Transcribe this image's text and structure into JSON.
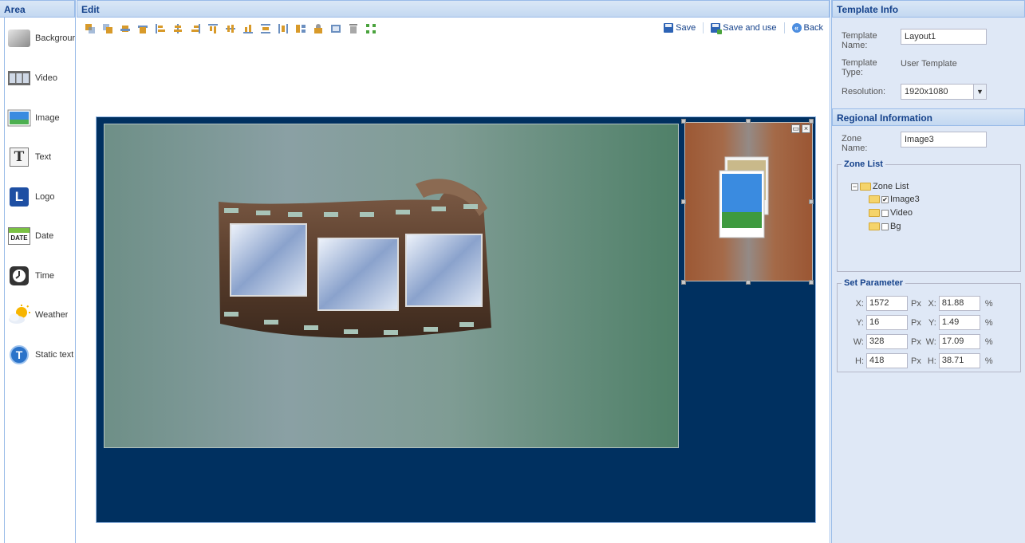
{
  "area": {
    "title": "Area",
    "items": [
      {
        "label": "Backgrour",
        "icon": "background-icon"
      },
      {
        "label": "Video",
        "icon": "video-icon"
      },
      {
        "label": "Image",
        "icon": "image-icon"
      },
      {
        "label": "Text",
        "icon": "text-icon"
      },
      {
        "label": "Logo",
        "icon": "logo-icon"
      },
      {
        "label": "Date",
        "icon": "date-icon"
      },
      {
        "label": "Time",
        "icon": "time-icon"
      },
      {
        "label": "Weather",
        "icon": "weather-icon"
      },
      {
        "label": "Static text",
        "icon": "static-text-icon"
      }
    ],
    "logo_letter": "L",
    "date_badge": "DATE",
    "text_glyph": "T",
    "static_glyph": "T"
  },
  "edit": {
    "title": "Edit",
    "toolbar": {
      "save_label": "Save",
      "save_and_use_label": "Save and use",
      "back_label": "Back"
    }
  },
  "template_info": {
    "title": "Template Info",
    "name_label": "Template Name:",
    "name_value": "Layout1",
    "type_label": "Template Type:",
    "type_value": "User Template",
    "resolution_label": "Resolution:",
    "resolution_value": "1920x1080"
  },
  "regional_info": {
    "title": "Regional Information",
    "zone_name_label": "Zone Name:",
    "zone_name_value": "Image3",
    "zone_list_legend": "Zone List",
    "tree_root": "Zone List",
    "tree_items": [
      {
        "label": "Image3",
        "checked": true
      },
      {
        "label": "Video",
        "checked": false
      },
      {
        "label": "Bg",
        "checked": false
      }
    ]
  },
  "set_parameter": {
    "legend": "Set Parameter",
    "px_unit": "Px",
    "pct_unit": "%",
    "rows": [
      {
        "key": "X:",
        "px": "1572",
        "pct": "81.88"
      },
      {
        "key": "Y:",
        "px": "16",
        "pct": "1.49"
      },
      {
        "key": "W:",
        "px": "328",
        "pct": "17.09"
      },
      {
        "key": "H:",
        "px": "418",
        "pct": "38.71"
      }
    ]
  },
  "colors": {
    "canvas_bg": "#003060",
    "header_text": "#15428b",
    "panel_bg": "#dfe8f6"
  }
}
